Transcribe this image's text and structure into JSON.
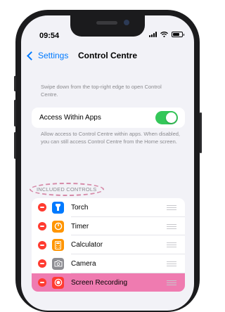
{
  "status_bar": {
    "time": "09:54"
  },
  "nav": {
    "back_label": "Settings",
    "title": "Control Centre"
  },
  "intro_text": "Swipe down from the top-right edge to open Control Centre.",
  "access_within_apps": {
    "label": "Access Within Apps",
    "enabled": true,
    "footer": "Allow access to Control Centre within apps. When disabled, you can still access Control Centre from the Home screen."
  },
  "included_controls": {
    "header": "INCLUDED CONTROLS",
    "items": [
      {
        "label": "Torch",
        "icon": "torch-icon",
        "color": "#007aff"
      },
      {
        "label": "Timer",
        "icon": "timer-icon",
        "color": "#ff9500"
      },
      {
        "label": "Calculator",
        "icon": "calculator-icon",
        "color": "#ff9500"
      },
      {
        "label": "Camera",
        "icon": "camera-icon",
        "color": "#8e8e93"
      },
      {
        "label": "Screen Recording",
        "icon": "screen-recording-icon",
        "color": "#ff3b30",
        "highlighted": true
      }
    ]
  },
  "colors": {
    "accent": "#007aff",
    "toggle_on": "#34c759",
    "remove": "#ff3b30",
    "highlight": "#ef7bb0",
    "annotation": "#d68aa8"
  }
}
